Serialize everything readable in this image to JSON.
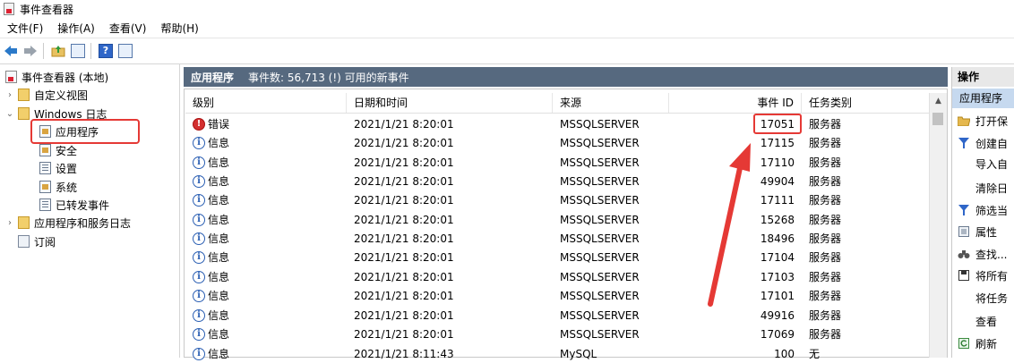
{
  "window": {
    "title": "事件查看器"
  },
  "menu": [
    "文件(F)",
    "操作(A)",
    "查看(V)",
    "帮助(H)"
  ],
  "toolbar": {
    "icons": [
      "back-arrow-icon",
      "forward-arrow-icon",
      "up-folder-icon",
      "show-hide-tree-icon",
      "help-icon",
      "properties-icon"
    ],
    "help_glyph": "?"
  },
  "tree": {
    "root": "事件查看器 (本地)",
    "custom_views": "自定义视图",
    "windows_logs": "Windows 日志",
    "application": "应用程序",
    "security": "安全",
    "setup": "设置",
    "system": "系统",
    "forwarded": "已转发事件",
    "app_service_logs": "应用程序和服务日志",
    "subscriptions": "订阅",
    "expand_collapsed": "›",
    "expand_open": "⌄"
  },
  "center": {
    "log_name": "应用程序",
    "count_text": "事件数: 56,713 (!) 可用的新事件"
  },
  "columns": {
    "level": "级别",
    "datetime": "日期和时间",
    "source": "来源",
    "event_id": "事件 ID",
    "category": "任务类别"
  },
  "events": [
    {
      "icon": "!",
      "level": "错误",
      "datetime": "2021/1/21 8:20:01",
      "source": "MSSQLSERVER",
      "event_id": "17051",
      "category": "服务器"
    },
    {
      "icon": "i",
      "level": "信息",
      "datetime": "2021/1/21 8:20:01",
      "source": "MSSQLSERVER",
      "event_id": "17115",
      "category": "服务器"
    },
    {
      "icon": "i",
      "level": "信息",
      "datetime": "2021/1/21 8:20:01",
      "source": "MSSQLSERVER",
      "event_id": "17110",
      "category": "服务器"
    },
    {
      "icon": "i",
      "level": "信息",
      "datetime": "2021/1/21 8:20:01",
      "source": "MSSQLSERVER",
      "event_id": "49904",
      "category": "服务器"
    },
    {
      "icon": "i",
      "level": "信息",
      "datetime": "2021/1/21 8:20:01",
      "source": "MSSQLSERVER",
      "event_id": "17111",
      "category": "服务器"
    },
    {
      "icon": "i",
      "level": "信息",
      "datetime": "2021/1/21 8:20:01",
      "source": "MSSQLSERVER",
      "event_id": "15268",
      "category": "服务器"
    },
    {
      "icon": "i",
      "level": "信息",
      "datetime": "2021/1/21 8:20:01",
      "source": "MSSQLSERVER",
      "event_id": "18496",
      "category": "服务器"
    },
    {
      "icon": "i",
      "level": "信息",
      "datetime": "2021/1/21 8:20:01",
      "source": "MSSQLSERVER",
      "event_id": "17104",
      "category": "服务器"
    },
    {
      "icon": "i",
      "level": "信息",
      "datetime": "2021/1/21 8:20:01",
      "source": "MSSQLSERVER",
      "event_id": "17103",
      "category": "服务器"
    },
    {
      "icon": "i",
      "level": "信息",
      "datetime": "2021/1/21 8:20:01",
      "source": "MSSQLSERVER",
      "event_id": "17101",
      "category": "服务器"
    },
    {
      "icon": "i",
      "level": "信息",
      "datetime": "2021/1/21 8:20:01",
      "source": "MSSQLSERVER",
      "event_id": "49916",
      "category": "服务器"
    },
    {
      "icon": "i",
      "level": "信息",
      "datetime": "2021/1/21 8:20:01",
      "source": "MSSQLSERVER",
      "event_id": "17069",
      "category": "服务器"
    },
    {
      "icon": "i",
      "level": "信息",
      "datetime": "2021/1/21 8:11:43",
      "source": "MySQL",
      "event_id": "100",
      "category": "无"
    }
  ],
  "scroll": {
    "up_glyph": "▲"
  },
  "actions": {
    "title": "操作",
    "section": "应用程序",
    "items": [
      {
        "icon": "📂",
        "label": "打开保"
      },
      {
        "icon": "▼",
        "label": "创建自"
      },
      {
        "icon": "",
        "label": "导入自"
      },
      {
        "icon": "",
        "label": "清除日"
      },
      {
        "icon": "▼",
        "label": "筛选当"
      },
      {
        "icon": "▤",
        "label": "属性"
      },
      {
        "icon": "⚲",
        "label": "查找..."
      },
      {
        "icon": "▣",
        "label": "将所有"
      },
      {
        "icon": "",
        "label": "将任务"
      },
      {
        "icon": "",
        "label": "查看"
      },
      {
        "icon": "↻",
        "label": "刷新"
      }
    ]
  },
  "colors": {
    "header_bg": "#56697f",
    "annotation_red": "#e53935",
    "selection_bg": "#c6d9ef"
  }
}
